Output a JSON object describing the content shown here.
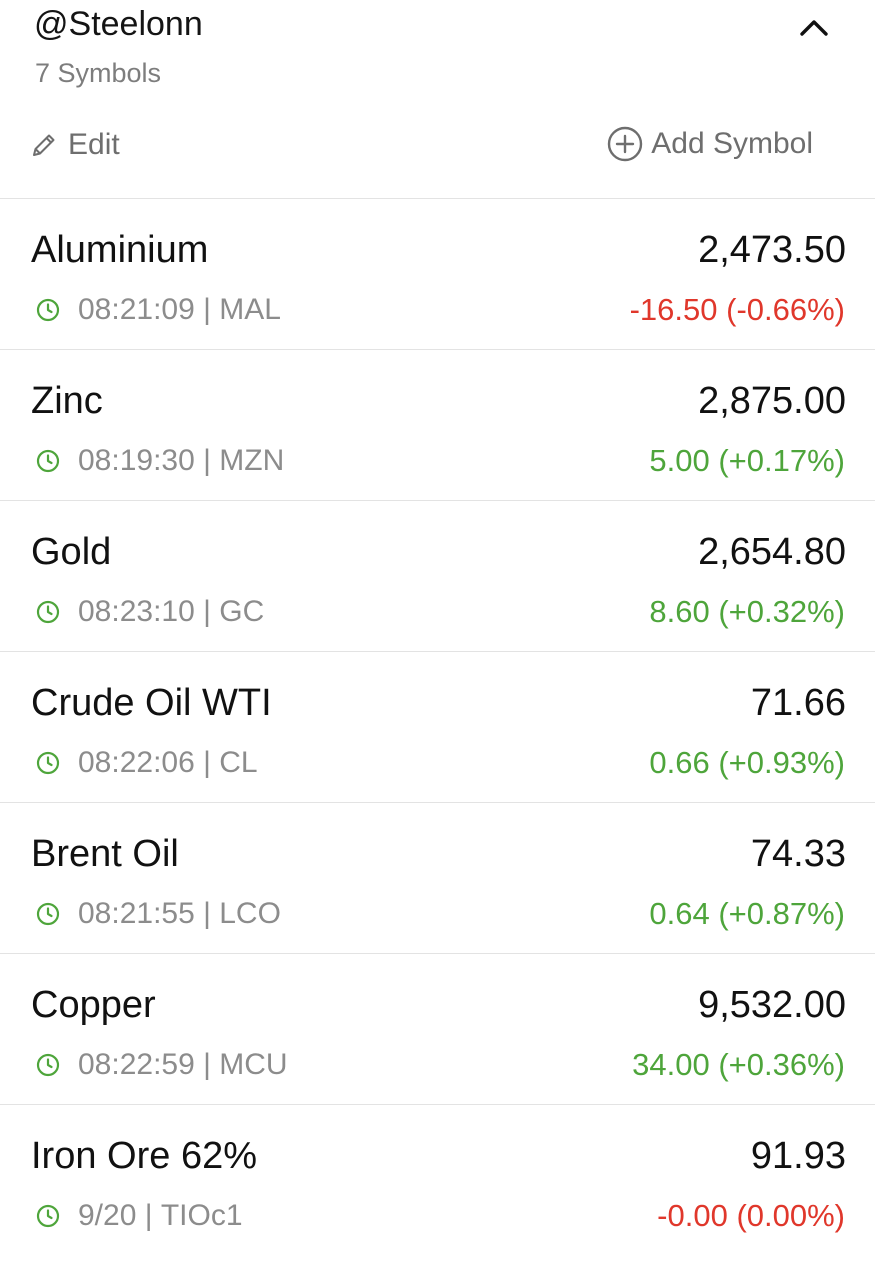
{
  "header": {
    "title": "@Steelonn",
    "subtitle": "7 Symbols",
    "edit_label": "Edit",
    "add_label": "Add Symbol",
    "collapse_icon": "chevron-up-icon",
    "edit_icon": "pencil-icon",
    "add_icon": "plus-circle-icon"
  },
  "colors": {
    "up": "#4ea53b",
    "down": "#e0372b",
    "clock": "#4ea53b",
    "muted": "#8c8c8c"
  },
  "symbols": [
    {
      "name": "Aluminium",
      "price": "2,473.50",
      "time": "08:21:09",
      "ticker": "MAL",
      "change": "-16.50 (-0.66%)",
      "direction": "down"
    },
    {
      "name": "Zinc",
      "price": "2,875.00",
      "time": "08:19:30",
      "ticker": "MZN",
      "change": "5.00 (+0.17%)",
      "direction": "up"
    },
    {
      "name": "Gold",
      "price": "2,654.80",
      "time": "08:23:10",
      "ticker": "GC",
      "change": "8.60 (+0.32%)",
      "direction": "up"
    },
    {
      "name": "Crude Oil WTI",
      "price": "71.66",
      "time": "08:22:06",
      "ticker": "CL",
      "change": "0.66 (+0.93%)",
      "direction": "up"
    },
    {
      "name": "Brent Oil",
      "price": "74.33",
      "time": "08:21:55",
      "ticker": "LCO",
      "change": "0.64 (+0.87%)",
      "direction": "up"
    },
    {
      "name": "Copper",
      "price": "9,532.00",
      "time": "08:22:59",
      "ticker": "MCU",
      "change": "34.00 (+0.36%)",
      "direction": "up"
    },
    {
      "name": "Iron Ore 62%",
      "price": "91.93",
      "time": "9/20",
      "ticker": "TIOc1",
      "change": "-0.00 (0.00%)",
      "direction": "down"
    }
  ]
}
